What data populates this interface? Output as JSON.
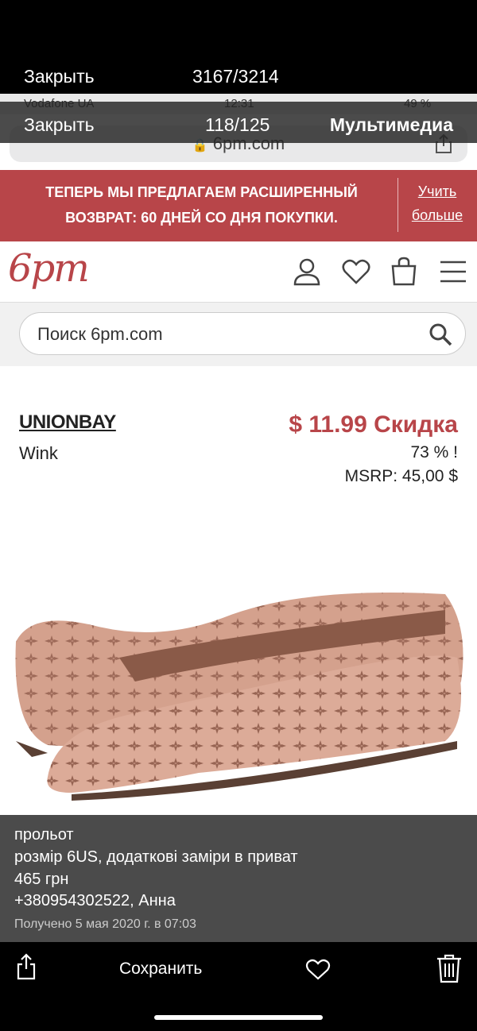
{
  "viewer": {
    "close_label": "Закрыть",
    "counter": "3167/3214",
    "save_label": "Сохранить"
  },
  "inner_viewer": {
    "status_carrier": "Vodafone UA",
    "status_time": "12:31",
    "status_battery": "49 %",
    "close_label": "Закрыть",
    "counter": "118/125",
    "media_label": "Мультимедиа"
  },
  "browser": {
    "url": "6pm.com"
  },
  "banner": {
    "line1": "ТЕПЕРЬ МЫ ПРЕДЛАГАЕМ РАСШИРЕННЫЙ",
    "line2": "ВОЗВРАТ: 60 ДНЕЙ СО ДНЯ ПОКУПКИ.",
    "link_line1": "Учить",
    "link_line2": "больше"
  },
  "site": {
    "logo": "6pm",
    "search_placeholder": "Поиск 6pm.com"
  },
  "product": {
    "brand": "UNIONBAY",
    "model": "Wink",
    "price": "$ 11.99 Скидка",
    "discount": "73 % !",
    "msrp": "MSRP: 45,00 $",
    "color_hint": "#d8a592"
  },
  "caption": {
    "line1": "прольот",
    "line2": "розмір 6US, додаткові заміри в приват",
    "line3": "465 грн",
    "line4": "+380954302522, Анна",
    "line5": "Получено 5 мая 2020 г. в 07:03"
  },
  "icons": {
    "share": "share-icon",
    "heart": "heart-icon",
    "trash": "trash-icon",
    "account": "account-icon",
    "cart": "cart-icon",
    "menu": "menu-icon",
    "search": "search-icon"
  },
  "colors": {
    "brand_red": "#b84549",
    "overlay": "#232323"
  }
}
